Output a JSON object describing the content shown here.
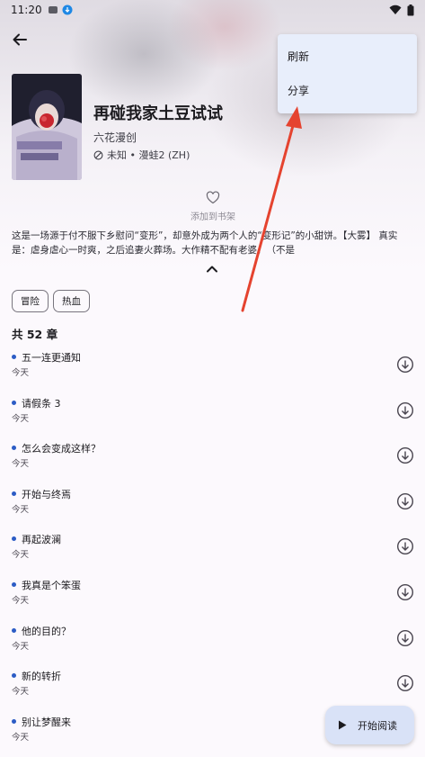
{
  "status": {
    "time": "11:20"
  },
  "header": {
    "back_icon": "arrow-left-icon"
  },
  "comic": {
    "title": "再碰我家土豆试试",
    "author": "六花漫创",
    "meta": "未知 • 漫蛙2 (ZH)",
    "favorite_label": "添加到书架",
    "description": "这是一场源于付不服下乡慰问“变形”，却意外成为两个人的“变形记”的小甜饼。【大雾】 真实是：虐身虐心一时爽，之后追妻火葬场。大作精不配有老婆！（不是",
    "tags": [
      "冒险",
      "热血"
    ],
    "chapter_count": "共 52 章"
  },
  "chapters": [
    {
      "title": "五一连更通知",
      "date": "今天"
    },
    {
      "title": "请假条 3",
      "date": "今天"
    },
    {
      "title": "怎么会变成这样？",
      "date": "今天"
    },
    {
      "title": "开始与终焉",
      "date": "今天"
    },
    {
      "title": "再起波澜",
      "date": "今天"
    },
    {
      "title": "我真是个笨蛋",
      "date": "今天"
    },
    {
      "title": "他的目的？",
      "date": "今天"
    },
    {
      "title": "新的转折",
      "date": "今天"
    },
    {
      "title": "别让梦醒来",
      "date": "今天"
    }
  ],
  "menu": {
    "items": [
      "刷新",
      "分享"
    ]
  },
  "fab": {
    "label": "开始阅读"
  },
  "colors": {
    "accent": "#2c5cc5",
    "arrow": "#e5432f",
    "menu_bg": "#e8eefb",
    "fab_bg": "#d9e2f7"
  }
}
